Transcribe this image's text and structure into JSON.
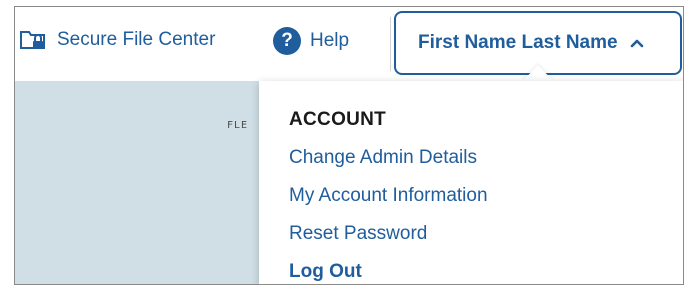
{
  "header": {
    "secure_file_center": "Secure File Center",
    "help": "Help",
    "user_name": "First Name Last Name",
    "icons": {
      "secure_file_center": "folder-lock-icon",
      "help": "question-circle-icon",
      "user_menu": "chevron-up-icon"
    }
  },
  "content": {
    "background_label": "FLE"
  },
  "account_menu": {
    "section_title": "ACCOUNT",
    "items": [
      {
        "label": "Change Admin Details"
      },
      {
        "label": "My Account Information"
      },
      {
        "label": "Reset Password"
      },
      {
        "label": "Log Out"
      }
    ]
  },
  "colors": {
    "accent": "#1f5d9c",
    "content_background": "#cfdfe5",
    "text_dark": "#1a1a1a"
  }
}
